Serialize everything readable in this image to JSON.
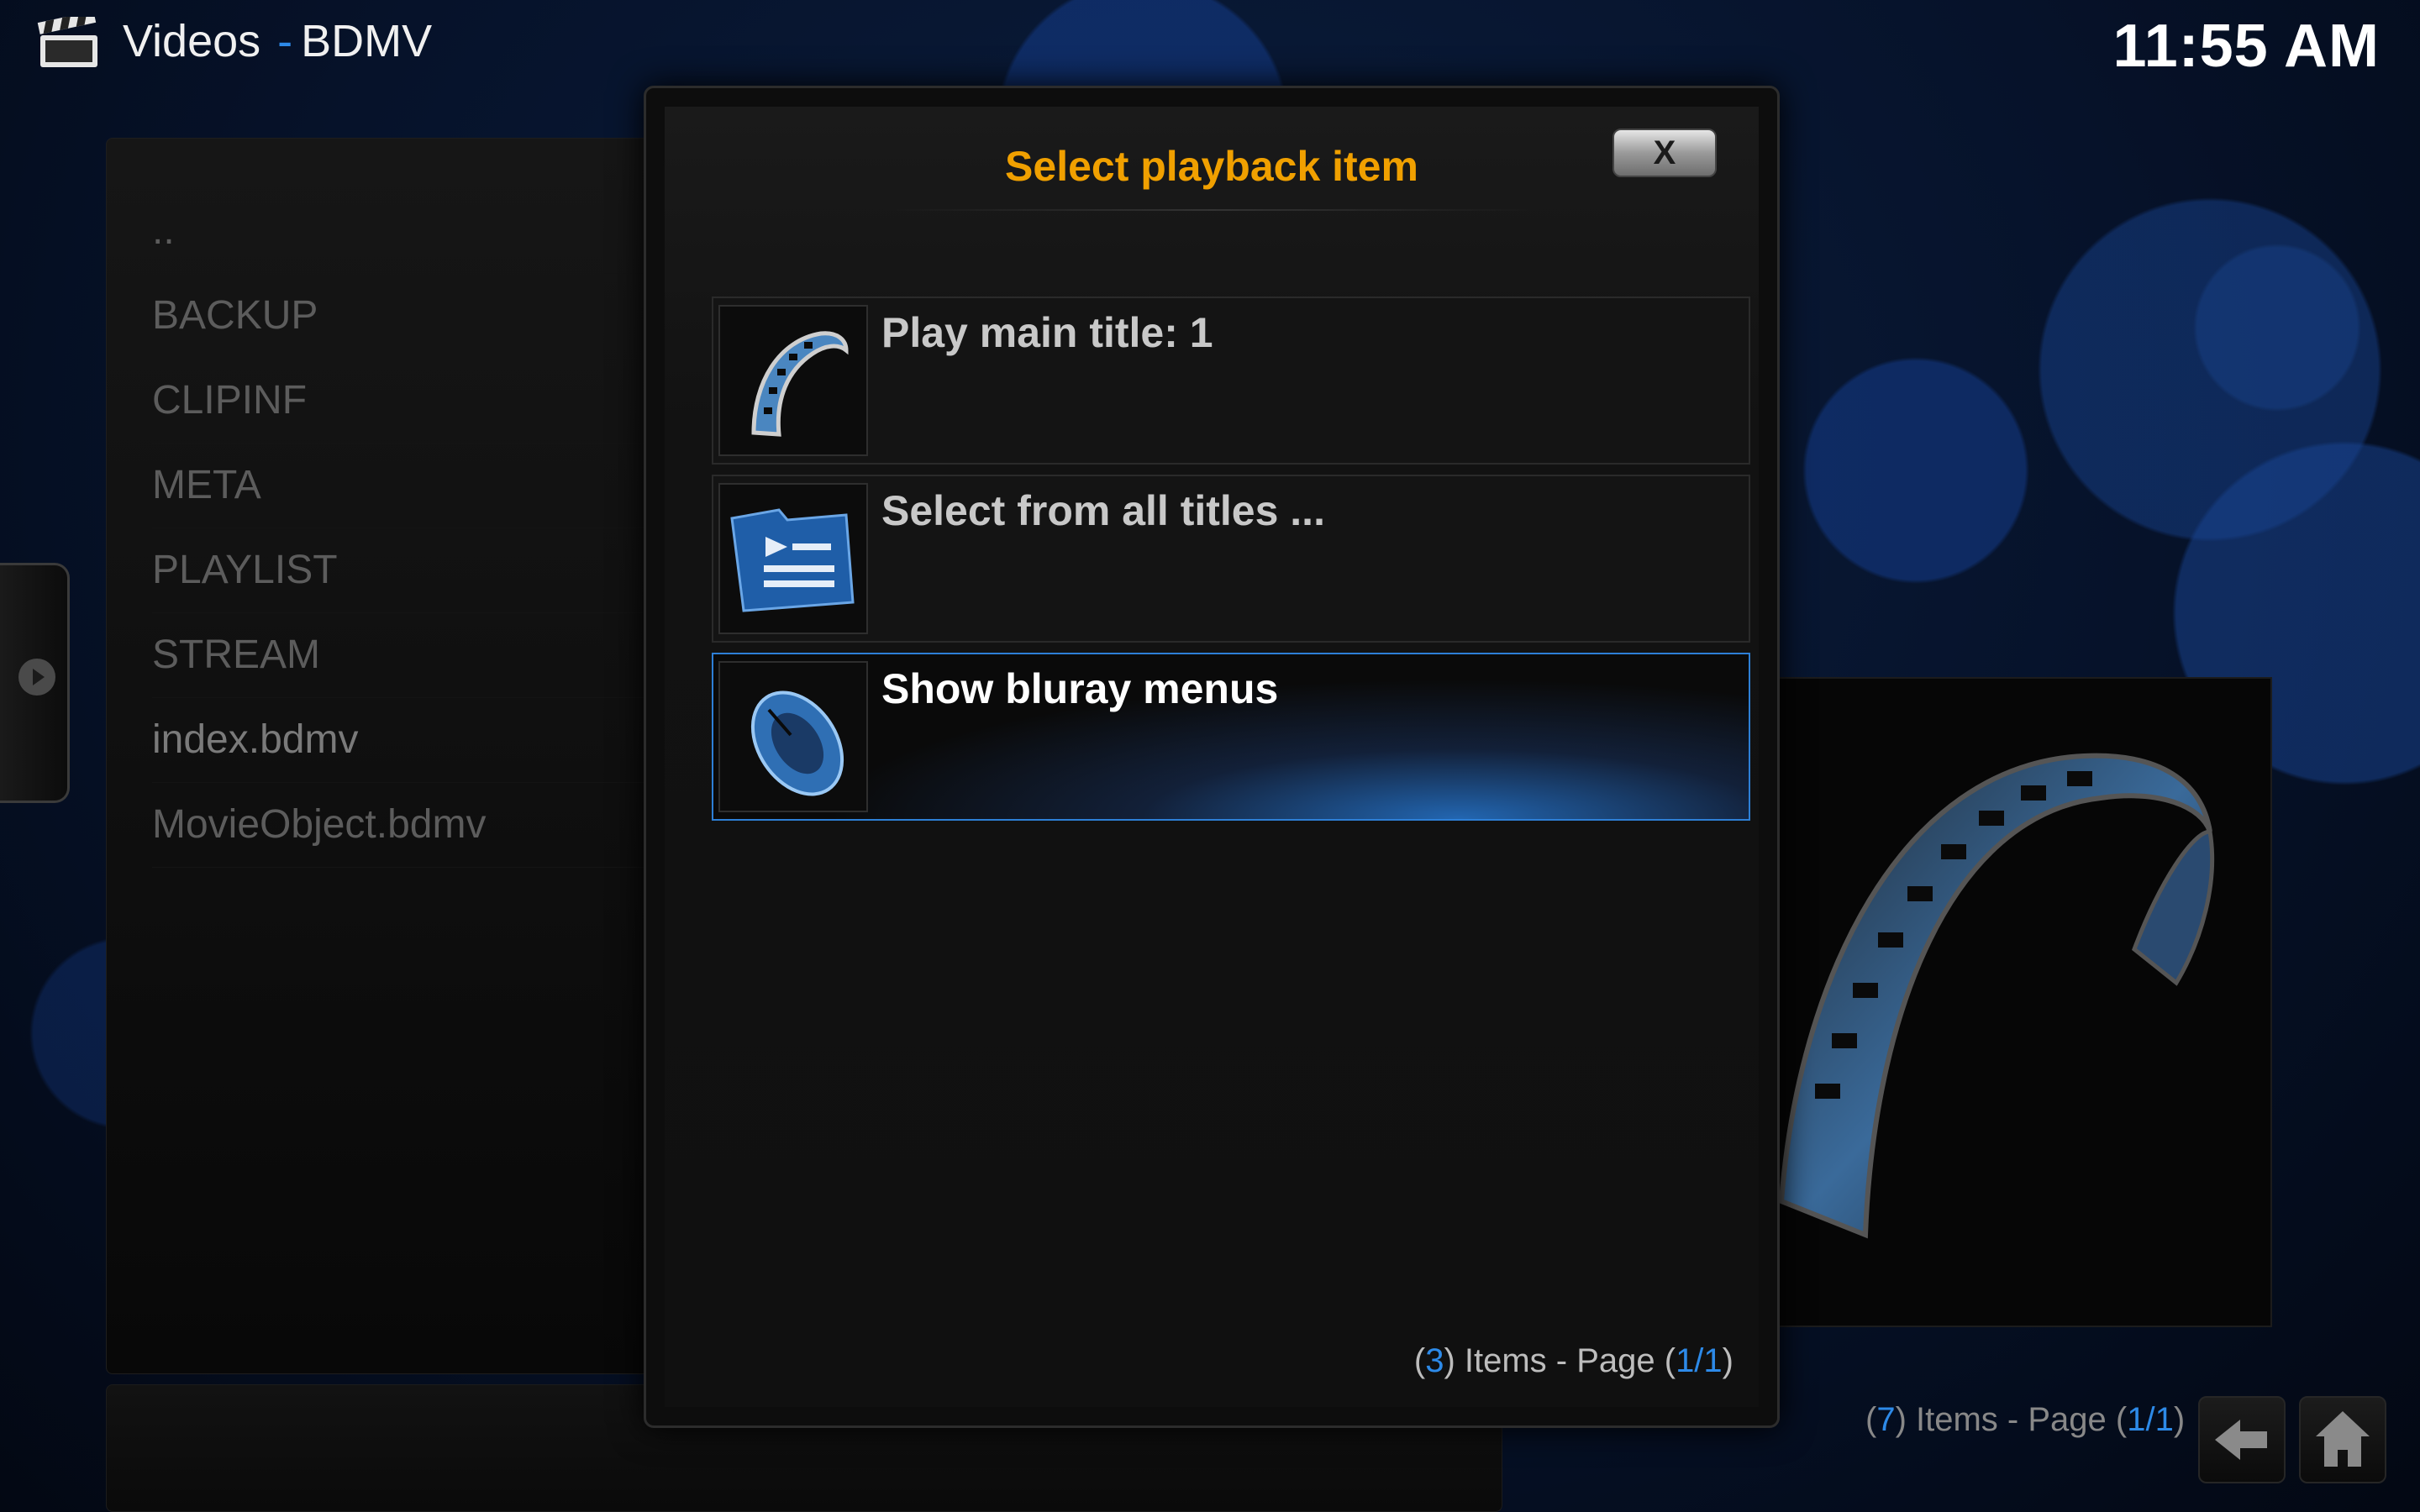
{
  "header": {
    "icon": "clapperboard-icon",
    "section": "Videos",
    "separator": "-",
    "path": "BDMV",
    "clock": "11:55 AM"
  },
  "file_list": {
    "items": [
      {
        "label": ".."
      },
      {
        "label": "BACKUP"
      },
      {
        "label": "CLIPINF"
      },
      {
        "label": "META"
      },
      {
        "label": "PLAYLIST"
      },
      {
        "label": "STREAM"
      },
      {
        "label": "index.bdmv"
      },
      {
        "label": "MovieObject.bdmv"
      }
    ]
  },
  "footer": {
    "count_open": "(",
    "count": "7",
    "count_text": ") Items - Page (",
    "page": "1/1",
    "page_close": ")",
    "back_icon": "back-arrow-icon",
    "home_icon": "home-icon"
  },
  "dialog": {
    "title": "Select playback item",
    "close_label": "X",
    "options": [
      {
        "label": "Play main title: 1",
        "icon": "film-reel-icon"
      },
      {
        "label": "Select from all titles ...",
        "icon": "folder-list-icon"
      },
      {
        "label": "Show bluray menus",
        "icon": "mouse-icon"
      }
    ],
    "count_open": "(",
    "count": "3",
    "count_text": ") Items - Page (",
    "page": "1/1",
    "page_close": ")"
  },
  "colors": {
    "accent": "#2d8ae8",
    "dialog_title": "#f0a000",
    "focus_border": "#2d7fd6"
  }
}
